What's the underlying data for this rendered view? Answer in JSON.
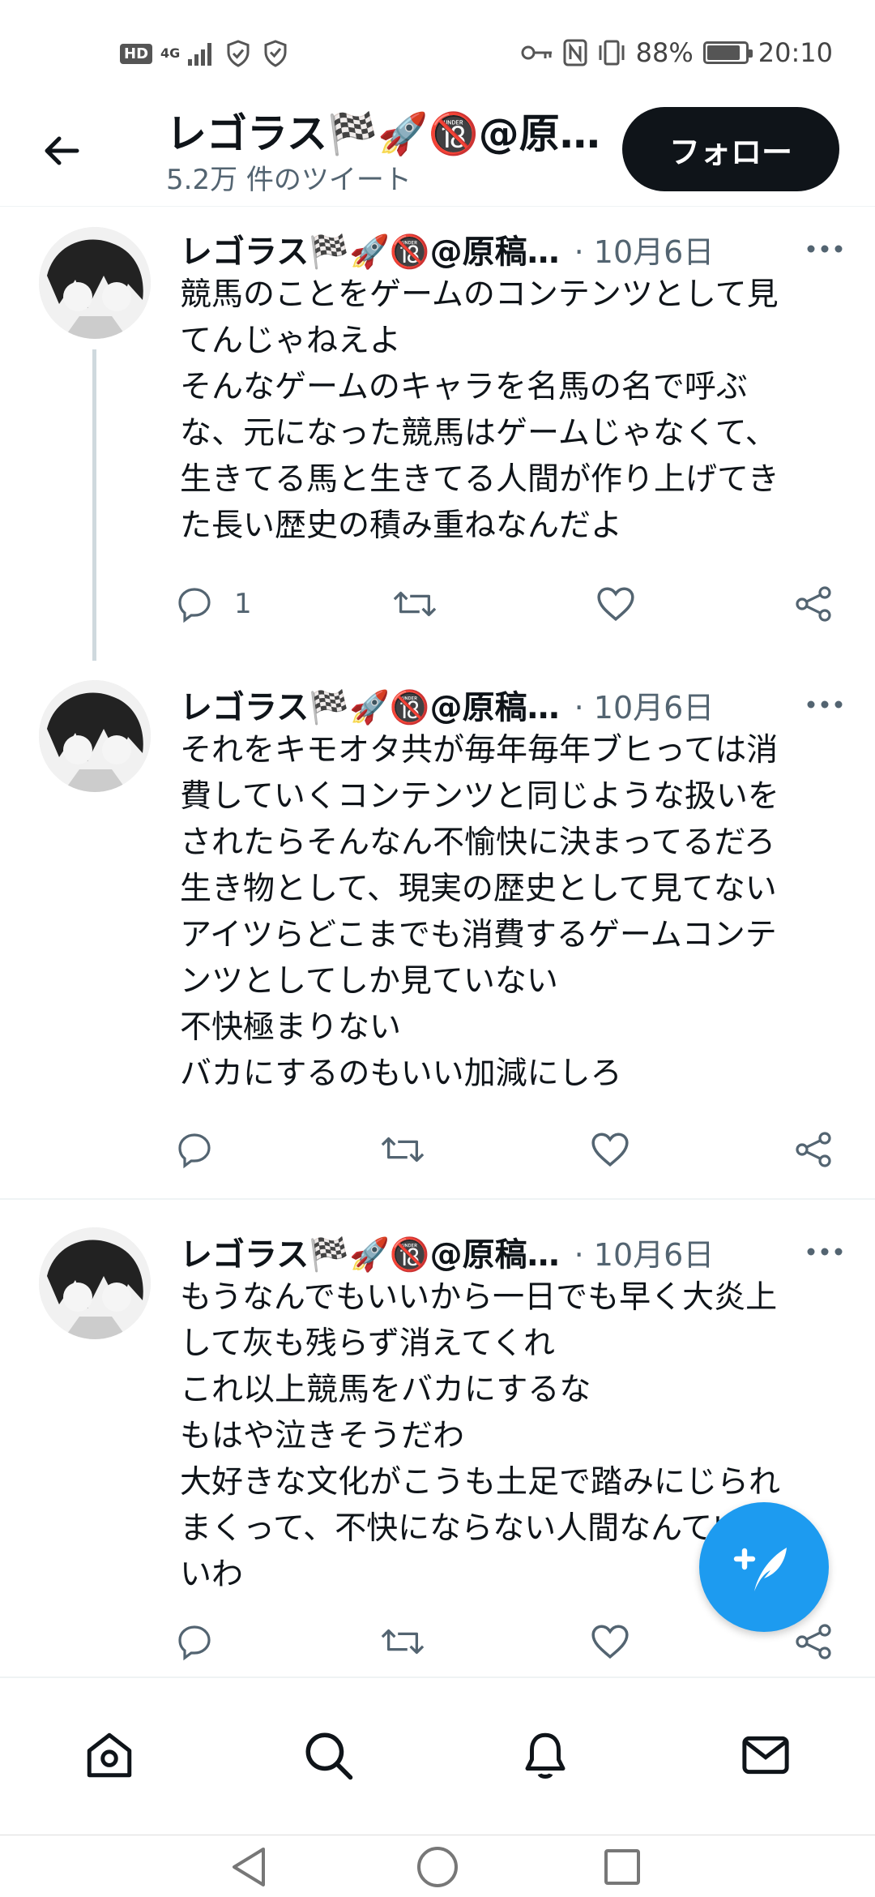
{
  "status_bar": {
    "hd_badge": "HD",
    "network": "4G",
    "battery_text": "88%",
    "battery_level": 0.88,
    "time": "20:10",
    "icons": [
      "signal-icon",
      "shield-check-icon",
      "shield-icon",
      "key-icon",
      "nfc-icon",
      "vibrate-icon",
      "battery-icon"
    ]
  },
  "header": {
    "title": "レゴラス🏁🚀🔞@原稿…",
    "subtitle": "5.2万 件のツイート",
    "follow_label": "フォロー"
  },
  "tweets": [
    {
      "name": "レゴラス🏁🚀🔞@原稿…",
      "date": "· 10月6日",
      "lines": [
        "競馬のことをゲームのコンテンツとして見",
        "てんじゃねえよ",
        "そんなゲームのキャラを名馬の名で呼ぶ",
        "な、元になった競馬はゲームじゃなくて、",
        "生きてる馬と生きてる人間が作り上げてき",
        "た長い歴史の積み重ねなんだよ"
      ],
      "reply_count": "1"
    },
    {
      "name": "レゴラス🏁🚀🔞@原稿…",
      "date": "· 10月6日",
      "lines": [
        "それをキモオタ共が毎年毎年ブヒっては消",
        "費していくコンテンツと同じような扱いを",
        "されたらそんなん不愉快に決まってるだろ",
        "生き物として、現実の歴史として見てない",
        "アイツらどこまでも消費するゲームコンテ",
        "ンツとしてしか見ていない",
        "不快極まりない",
        "バカにするのもいい加減にしろ"
      ]
    },
    {
      "name": "レゴラス🏁🚀🔞@原稿…",
      "date": "· 10月6日",
      "lines": [
        "もうなんでもいいから一日でも早く大炎上",
        "して灰も残らず消えてくれ",
        "これ以上競馬をバカにするな",
        "もはや泣きそうだわ",
        "大好きな文化がこうも土足で踏みにじられ",
        "まくって、不快にならない人間なんていな",
        "いわ"
      ]
    }
  ],
  "colors": {
    "accent": "#1d9bf0",
    "text": "#0f1419",
    "secondary": "#536471",
    "follow_bg": "#0f1419"
  }
}
